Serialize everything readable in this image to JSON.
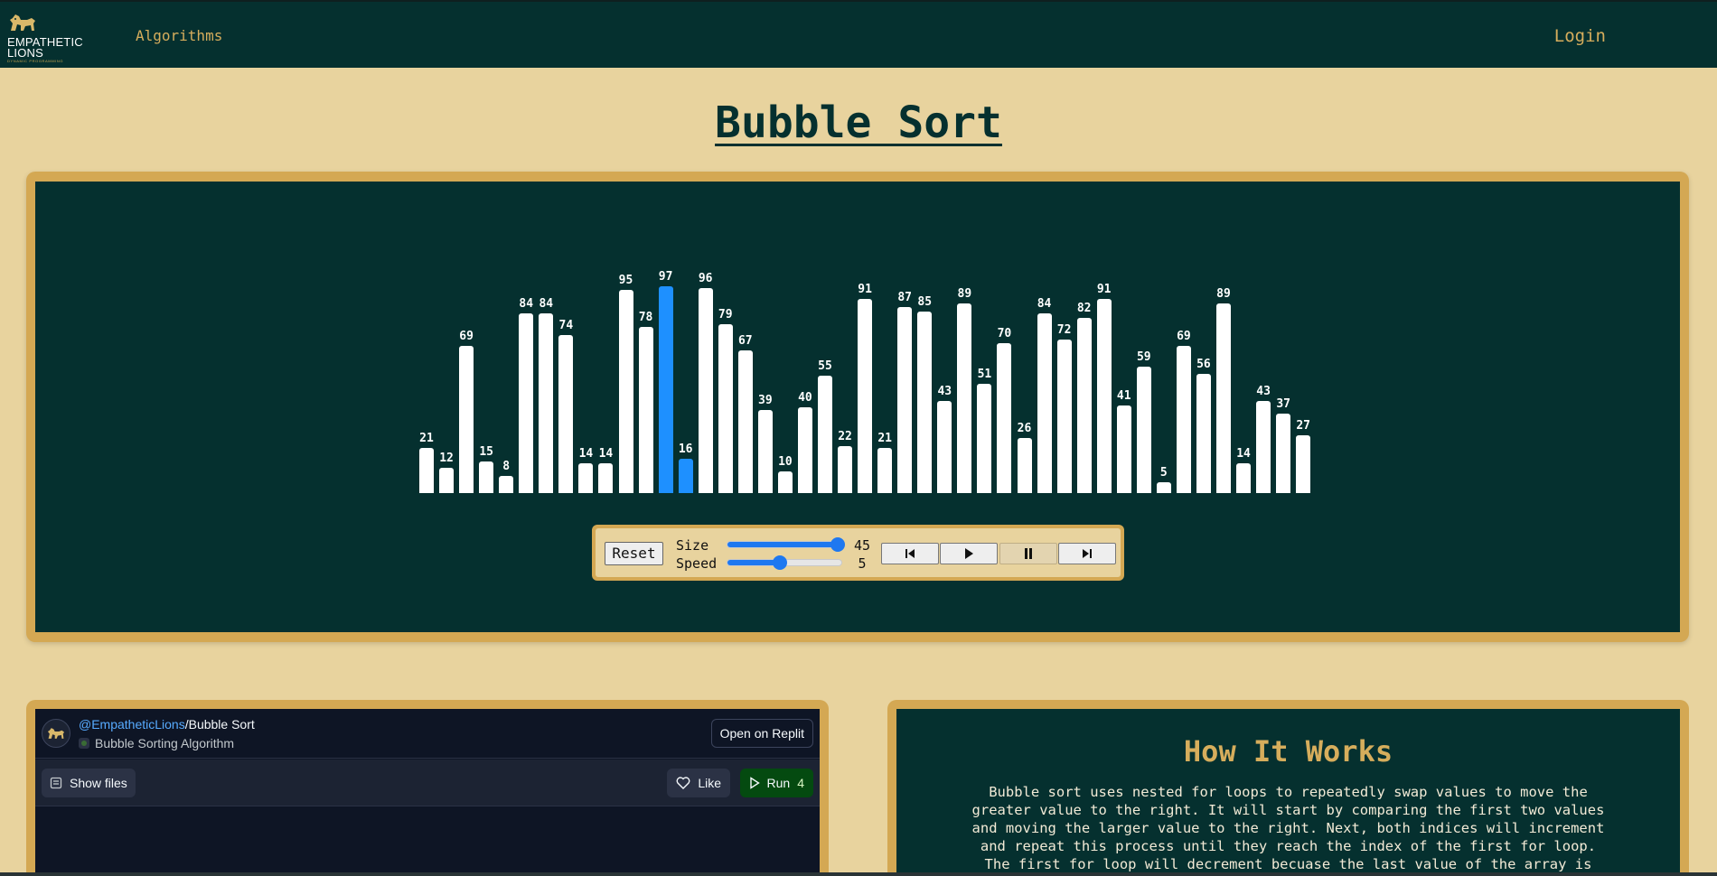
{
  "navbar": {
    "logo_line1": "EMPATHETIC",
    "logo_line2": "LIONS",
    "logo_sub": "DYNAMIC PROGRAMMING",
    "algorithms_link": "Algorithms",
    "login_link": "Login"
  },
  "page": {
    "title": "Bubble Sort"
  },
  "visualizer": {
    "values": [
      21,
      12,
      69,
      15,
      8,
      84,
      84,
      74,
      14,
      14,
      95,
      78,
      97,
      16,
      96,
      79,
      67,
      39,
      10,
      40,
      55,
      22,
      91,
      21,
      87,
      85,
      43,
      89,
      51,
      70,
      26,
      84,
      72,
      82,
      91,
      41,
      59,
      5,
      69,
      56,
      89,
      14,
      43,
      37,
      27
    ],
    "active_indices": [
      12,
      13
    ],
    "bar_color": "#ffffff",
    "active_color": "#1e90ff",
    "background_color": "#05302f"
  },
  "controls": {
    "reset_label": "Reset",
    "size_label": "Size",
    "speed_label": "Speed",
    "size_value": "45",
    "speed_value": "5",
    "size_fraction": 0.97,
    "speed_fraction": 0.46,
    "first_icon": "skip-back-icon",
    "play_icon": "play-icon",
    "pause_icon": "pause-icon",
    "next_icon": "skip-forward-icon"
  },
  "replit": {
    "owner": "@EmpatheticLions",
    "separator": "/",
    "repl_name": "Bubble Sort",
    "description": "Bubble Sorting Algorithm",
    "open_label": "Open on Replit",
    "show_files_label": "Show files",
    "like_label": "Like",
    "run_label": "Run",
    "run_count": "4"
  },
  "how_it_works": {
    "title": "How It Works",
    "text": "Bubble sort uses nested for loops to repeatedly swap values to move the greater value to the right. It will start by comparing the first two values and moving the larger value to the right. Next, both indices will increment and repeat this process until they reach the index of the first for loop. The first for loop will decrement becuase the last value of the array is now the largest and it will then repeat the whole process."
  }
}
